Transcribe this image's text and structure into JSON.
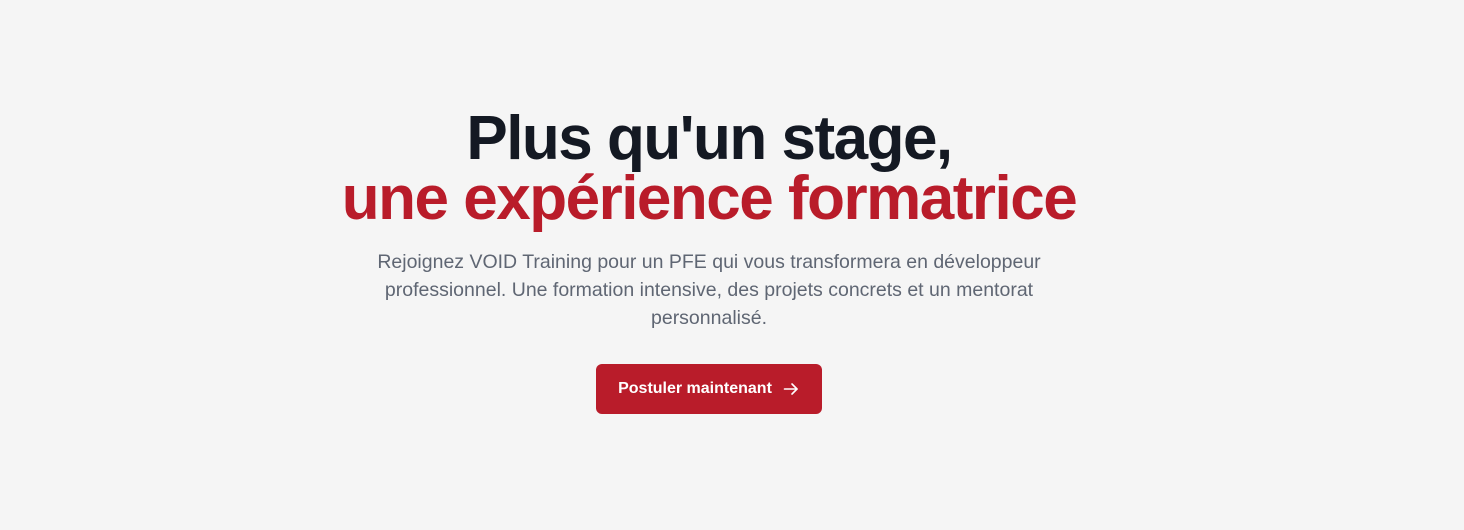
{
  "hero": {
    "title_line1": "Plus qu'un stage,",
    "title_line2": "une expérience formatrice",
    "subtitle": "Rejoignez VOID Training pour un PFE qui vous transformera en développeur professionnel. Une formation intensive, des projets concrets et un mentorat personnalisé.",
    "cta_label": "Postuler maintenant",
    "cta_icon": "arrow-right-icon"
  },
  "colors": {
    "background": "#f5f5f5",
    "title_dark": "#141923",
    "accent": "#b91c2a",
    "subtitle_text": "#5f6673",
    "button_text": "#ffffff"
  }
}
